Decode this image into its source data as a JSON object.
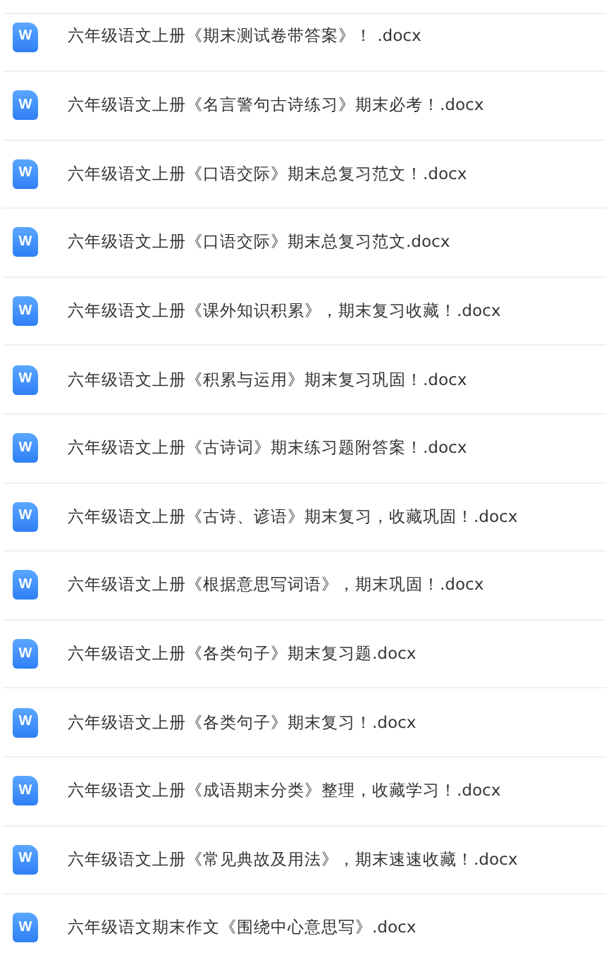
{
  "files": [
    {
      "icon_letter": "W",
      "name": "六年级语文上册《期末测试卷带答案》！ .docx"
    },
    {
      "icon_letter": "W",
      "name": "六年级语文上册《名言警句古诗练习》期末必考！.docx"
    },
    {
      "icon_letter": "W",
      "name": "六年级语文上册《口语交际》期末总复习范文！.docx"
    },
    {
      "icon_letter": "W",
      "name": "六年级语文上册《口语交际》期末总复习范文.docx"
    },
    {
      "icon_letter": "W",
      "name": "六年级语文上册《课外知识积累》，期末复习收藏！.docx"
    },
    {
      "icon_letter": "W",
      "name": "六年级语文上册《积累与运用》期末复习巩固！.docx"
    },
    {
      "icon_letter": "W",
      "name": "六年级语文上册《古诗词》期末练习题附答案！.docx"
    },
    {
      "icon_letter": "W",
      "name": "六年级语文上册《古诗、谚语》期末复习，收藏巩固！.docx"
    },
    {
      "icon_letter": "W",
      "name": "六年级语文上册《根据意思写词语》，期末巩固！.docx"
    },
    {
      "icon_letter": "W",
      "name": "六年级语文上册《各类句子》期末复习题.docx"
    },
    {
      "icon_letter": "W",
      "name": "六年级语文上册《各类句子》期末复习！.docx"
    },
    {
      "icon_letter": "W",
      "name": "六年级语文上册《成语期末分类》整理，收藏学习！.docx"
    },
    {
      "icon_letter": "W",
      "name": "六年级语文上册《常见典故及用法》，期末速速收藏！.docx"
    },
    {
      "icon_letter": "W",
      "name": "六年级语文期末作文《围绕中心意思写》.docx"
    }
  ]
}
